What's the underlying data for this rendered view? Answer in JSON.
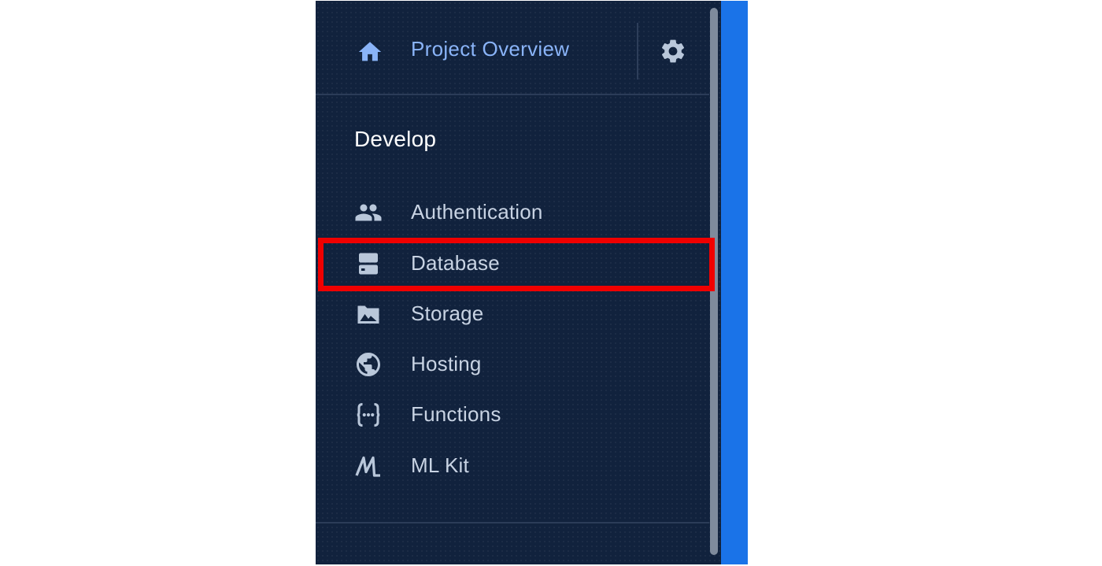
{
  "header": {
    "home_icon": "home-icon",
    "title": "Project Overview",
    "settings_icon": "gear-icon"
  },
  "develop": {
    "section_title": "Develop",
    "items": [
      {
        "label": "Authentication",
        "icon": "people-icon"
      },
      {
        "label": "Database",
        "icon": "database-icon"
      },
      {
        "label": "Storage",
        "icon": "image-folder-icon"
      },
      {
        "label": "Hosting",
        "icon": "globe-icon"
      },
      {
        "label": "Functions",
        "icon": "functions-icon"
      },
      {
        "label": "ML Kit",
        "icon": "ml-kit-icon"
      }
    ]
  },
  "highlight": {
    "target": "Database",
    "color": "#f00000"
  },
  "colors": {
    "sidebar_bg": "#11223d",
    "accent_blue": "#1a73e8",
    "title_blue": "#8ab4f8",
    "item_text": "#c8d3e3",
    "icon": "#b9c7da"
  }
}
